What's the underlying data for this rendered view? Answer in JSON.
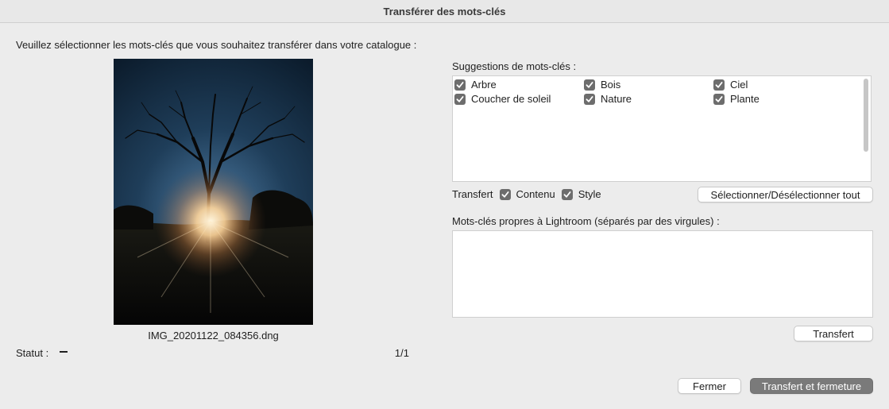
{
  "window": {
    "title": "Transférer des mots-clés"
  },
  "instruction": "Veuillez sélectionner les mots-clés que vous souhaitez transférer dans votre catalogue :",
  "image": {
    "filename": "IMG_20201122_084356.dng"
  },
  "status": {
    "label": "Statut :",
    "counter": "1/1"
  },
  "suggestions": {
    "label": "Suggestions de mots-clés :",
    "items": [
      {
        "label": "Arbre",
        "checked": true
      },
      {
        "label": "Bois",
        "checked": true
      },
      {
        "label": "Ciel",
        "checked": true
      },
      {
        "label": "Coucher de soleil",
        "checked": true
      },
      {
        "label": "Nature",
        "checked": true
      },
      {
        "label": "Plante",
        "checked": true
      }
    ]
  },
  "transfer_options": {
    "label": "Transfert",
    "content": {
      "label": "Contenu",
      "checked": true
    },
    "style": {
      "label": "Style",
      "checked": true
    }
  },
  "buttons": {
    "select_all": "Sélectionner/Désélectionner tout",
    "transfer": "Transfert",
    "close": "Fermer",
    "transfer_close": "Transfert et fermeture"
  },
  "lightroom": {
    "label": "Mots-clés propres à Lightroom (séparés par des virgules) :",
    "value": ""
  },
  "colors": {
    "checkbox": "#6d6d6d",
    "primary_button": "#7a7a7a",
    "background": "#ececec"
  }
}
